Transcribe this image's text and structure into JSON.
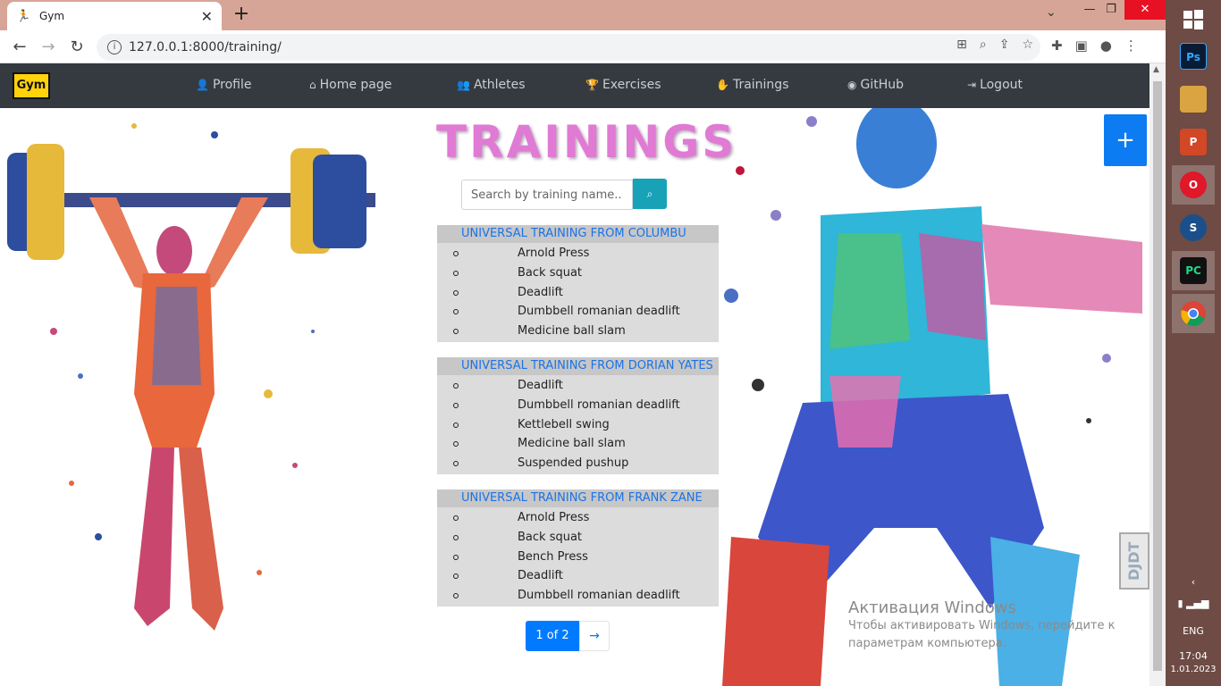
{
  "browser": {
    "tab_title": "Gym",
    "new_tab": "+",
    "url": "127.0.0.1:8000/training/",
    "close_tab": "✕"
  },
  "navbar": {
    "brand": "Gym",
    "links": [
      {
        "label": "Profile",
        "icon": "user-icon"
      },
      {
        "label": "Home page",
        "icon": "home-icon"
      },
      {
        "label": "Athletes",
        "icon": "users-icon"
      },
      {
        "label": "Exercises",
        "icon": "trophy-icon"
      },
      {
        "label": "Trainings",
        "icon": "hand-icon"
      },
      {
        "label": "GitHub",
        "icon": "github-icon"
      },
      {
        "label": "Logout",
        "icon": "logout-icon"
      }
    ]
  },
  "main": {
    "title": "TRAININGS",
    "search_placeholder": "Search by training name...",
    "add_label": "+",
    "trainings": [
      {
        "name": "UNIVERSAL TRAINING FROM COLUMBU",
        "exercises": [
          "Arnold Press",
          "Back squat",
          "Deadlift",
          "Dumbbell romanian deadlift",
          "Medicine ball slam"
        ]
      },
      {
        "name": "UNIVERSAL TRAINING FROM DORIAN YATES",
        "exercises": [
          "Deadlift",
          "Dumbbell romanian deadlift",
          "Kettlebell swing",
          "Medicine ball slam",
          "Suspended pushup"
        ]
      },
      {
        "name": "UNIVERSAL TRAINING FROM FRANK ZANE",
        "exercises": [
          "Arnold Press",
          "Back squat",
          "Bench Press",
          "Deadlift",
          "Dumbbell romanian deadlift"
        ]
      }
    ],
    "pagination": {
      "current": "1 of 2",
      "next": "→"
    }
  },
  "badge": "DJDT",
  "watermark": {
    "line1": "Активация Windows",
    "line2": "Чтобы активировать Windows, перейдите к",
    "line3": "параметрам компьютера."
  },
  "taskbar": {
    "apps": [
      "windows-start",
      "photoshop",
      "photos",
      "powerpoint",
      "opera",
      "steam",
      "pycharm",
      "chrome"
    ],
    "lang": "ENG",
    "time": "17:04",
    "date": "1.01.2023"
  },
  "colors": {
    "navbar_bg": "#343a40",
    "title": "#e07ad4",
    "primary": "#007bff",
    "search_btn": "#17a2b8",
    "brand_bg": "#ffd20c"
  }
}
